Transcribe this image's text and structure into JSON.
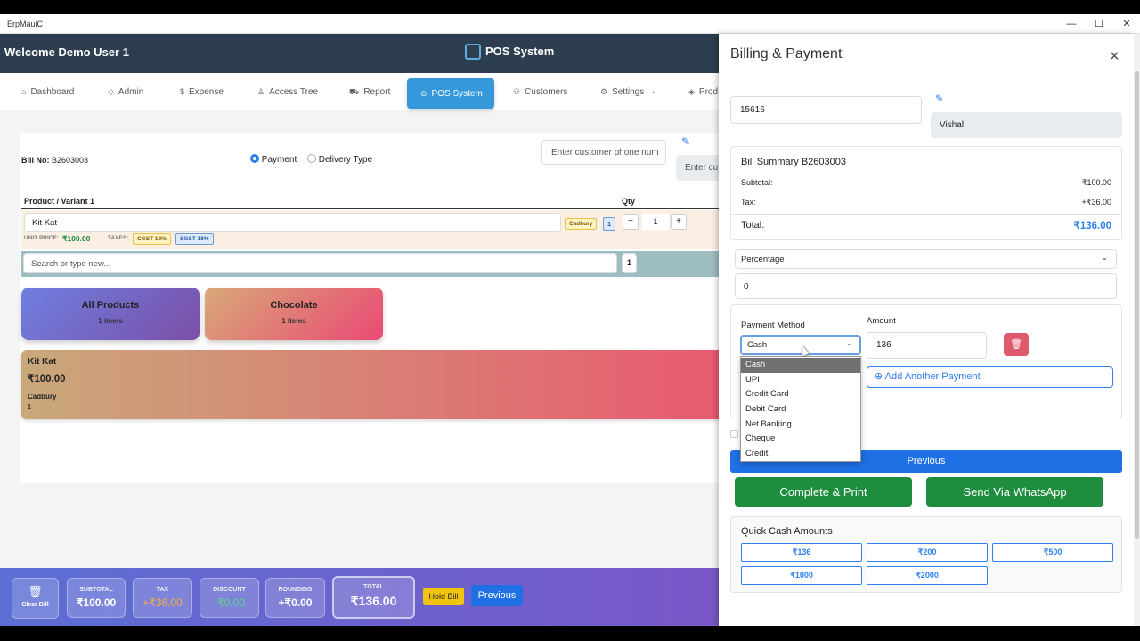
{
  "window": {
    "title": "ErpMauiC",
    "min": "—",
    "max": "☐",
    "close": "✕"
  },
  "header": {
    "welcome": "Welcome Demo User 1",
    "app_title": "POS System"
  },
  "nav": [
    {
      "label": "Dashboard",
      "icon": "⌂"
    },
    {
      "label": "Admin",
      "icon": "◇"
    },
    {
      "label": "Expense",
      "icon": "$"
    },
    {
      "label": "Access Tree",
      "icon": "♙"
    },
    {
      "label": "Report",
      "icon": "⛟"
    },
    {
      "label": "POS System",
      "icon": "⊙"
    },
    {
      "label": "Customers",
      "icon": "⚇"
    },
    {
      "label": "Settings",
      "icon": "⚙",
      "suffix": "·"
    },
    {
      "label": "Prod",
      "icon": "◈"
    }
  ],
  "bill": {
    "label": "Bill No:",
    "number": "B2603003",
    "payment_label": "Payment",
    "delivery_label": "Delivery Type",
    "phone_placeholder": "Enter customer phone num",
    "name_placeholder": "Enter cu"
  },
  "table": {
    "col_product": "Product / Variant 1",
    "col_qty": "Qty"
  },
  "item": {
    "name": "Kit Kat",
    "brand": "Cadbury",
    "badge": "1",
    "qty": "1",
    "minus": "−",
    "plus": "+",
    "unit_price_label": "UNIT PRICE:",
    "unit_price": "₹100.00",
    "taxes_label": "TAXES:",
    "tax1": "CGST 18%",
    "tax2": "SGST 18%"
  },
  "search": {
    "placeholder": "Search or type new...",
    "qty": "1"
  },
  "categories": [
    {
      "name": "All Products",
      "count": "1 items"
    },
    {
      "name": "Chocolate",
      "count": "1 items"
    }
  ],
  "product_card": {
    "name": "Kit Kat",
    "price": "₹100.00",
    "brand": "Cadbury",
    "stock": "1"
  },
  "footer": {
    "clear": "Clear Bill",
    "subtotal_label": "SUBTOTAL",
    "subtotal": "₹100.00",
    "tax_label": "TAX",
    "tax": "+₹36.00",
    "discount_label": "DISCOUNT",
    "discount": "-₹0.00",
    "rounding_label": "ROUNDING",
    "rounding": "+₹0.00",
    "total_label": "TOTAL",
    "total": "₹136.00",
    "hold": "Hold Bill",
    "previous": "Previous"
  },
  "drawer": {
    "title": "Billing & Payment",
    "customer_id": "15616",
    "customer_name": "Vishal",
    "summary_title": "Bill Summary B2603003",
    "subtotal_label": "Subtotal:",
    "subtotal": "₹100.00",
    "tax_label": "Tax:",
    "tax": "+₹36.00",
    "total_label": "Total:",
    "total": "₹136.00",
    "discount_type": "Percentage",
    "discount_value": "0",
    "payment_method_label": "Payment Method",
    "amount_label": "Amount",
    "payment_method": "Cash",
    "amount": "136",
    "add_payment": "Add Another Payment",
    "previous": "Previous",
    "complete": "Complete & Print",
    "whatsapp": "Send Via WhatsApp",
    "quick_title": "Quick Cash Amounts",
    "quick": [
      "₹136",
      "₹200",
      "₹500",
      "₹1000",
      "₹2000"
    ]
  },
  "dropdown": {
    "options": [
      "Cash",
      "UPI",
      "Credit Card",
      "Debit Card",
      "Net Banking",
      "Cheque",
      "Credit"
    ],
    "selected": "Cash"
  },
  "colors": {
    "topbar": "#2c3e50",
    "accent": "#3498db",
    "primary": "#2f80ed",
    "success": "#1e8e3e",
    "danger": "#e05a6d",
    "footer": "#6a63cc"
  }
}
